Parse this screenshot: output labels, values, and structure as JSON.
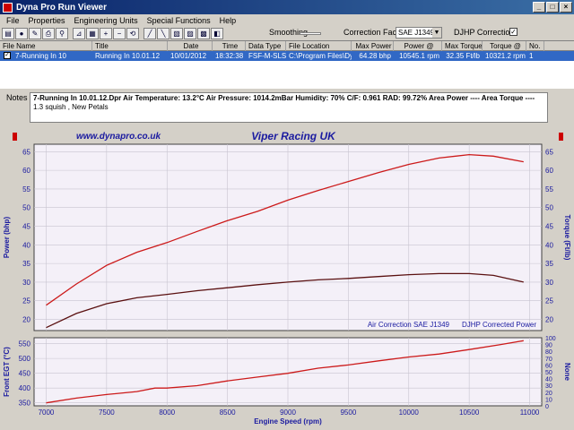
{
  "window": {
    "title": "Dyna Pro Run Viewer"
  },
  "menu": [
    "File",
    "Properties",
    "Engineering Units",
    "Special Functions",
    "Help"
  ],
  "toolbar": {
    "smoothing_label": "Smoothing",
    "correction_factor_label": "Correction Factor",
    "correction_factor_value": "SAE J1349",
    "djhp_label": "DJHP Correction",
    "djhp_checked": "✓"
  },
  "grid": {
    "headers": [
      "File Name",
      "Title",
      "Date",
      "Time",
      "Data Type",
      "File Location",
      "Max Power",
      "Power @",
      "Max Torque",
      "Torque @",
      "No."
    ],
    "rows": [
      [
        "7-Running In 10",
        "Running In 10.01.12",
        "10/01/2012",
        "18:32:38",
        "FSF-M-SLS",
        "C:\\Program Files\\Dy...",
        "64.28 bhp",
        "10545.1 rpm",
        "32.35 Ft/lb",
        "10321.2 rpm",
        "1"
      ]
    ]
  },
  "notes": {
    "label": "Notes",
    "line1": "7-Running In 10.01.12.Dpr   Air Temperature: 13.2°C   Air Pressure: 1014.2mBar   Humidity: 70%   C/F: 0.961   RAD: 99.72%   Area Power ----   Area Torque ----",
    "line2": "1.3 squish , New Petals"
  },
  "colors": {
    "power": "#cc1a1a",
    "torque": "#5a1010",
    "egt": "#cc1a1a",
    "plot_bg": "#f4f0f8",
    "accent_blue": "#1a1aa0"
  },
  "chart_data": [
    {
      "type": "line",
      "title": "Viper Racing UK",
      "subtitle": "www.dynapro.co.uk",
      "annotations": [
        "Air Correction SAE J1349",
        "DJHP Corrected Power"
      ],
      "xlabel": "",
      "ylabel": "Power (bhp)",
      "y2label": "Torque (Ft/lb)",
      "xlim": [
        6900,
        11100
      ],
      "ylim": [
        17,
        67
      ],
      "y2lim": [
        17,
        67
      ],
      "yticks": [
        20,
        25,
        30,
        35,
        40,
        45,
        50,
        55,
        60,
        65
      ],
      "grid": true,
      "series": [
        {
          "name": "Power (bhp)",
          "x": [
            7000,
            7250,
            7500,
            7750,
            8000,
            8250,
            8500,
            8750,
            9000,
            9250,
            9500,
            9750,
            10000,
            10250,
            10500,
            10700,
            10950
          ],
          "values": [
            23.8,
            29.5,
            34.5,
            38.0,
            40.6,
            43.6,
            46.5,
            49.0,
            52.0,
            54.6,
            57.0,
            59.4,
            61.6,
            63.3,
            64.2,
            63.8,
            62.3
          ]
        },
        {
          "name": "Torque (Ft/lb)",
          "x": [
            7000,
            7250,
            7500,
            7750,
            8000,
            8250,
            8500,
            8750,
            9000,
            9250,
            9500,
            9750,
            10000,
            10250,
            10500,
            10700,
            10950
          ],
          "values": [
            17.8,
            21.6,
            24.2,
            25.8,
            26.7,
            27.7,
            28.5,
            29.3,
            30.0,
            30.6,
            31.0,
            31.5,
            32.0,
            32.3,
            32.3,
            31.8,
            30.0
          ]
        }
      ]
    },
    {
      "type": "line",
      "xlabel": "Engine Speed (rpm)",
      "ylabel": "Front EGT (°C)",
      "y2label": "None",
      "xlim": [
        6900,
        11100
      ],
      "ylim": [
        340,
        570
      ],
      "y2lim": [
        0,
        100
      ],
      "yticks": [
        350,
        400,
        450,
        500,
        550
      ],
      "y2ticks": [
        0,
        10,
        20,
        30,
        40,
        50,
        60,
        70,
        80,
        90,
        100
      ],
      "xticks": [
        7000,
        7500,
        8000,
        8500,
        9000,
        9500,
        10000,
        10500,
        11000
      ],
      "grid": true,
      "series": [
        {
          "name": "Front EGT (°C)",
          "x": [
            7000,
            7250,
            7500,
            7750,
            7900,
            8000,
            8250,
            8500,
            8750,
            9000,
            9250,
            9500,
            9750,
            10000,
            10250,
            10500,
            10750,
            10950
          ],
          "values": [
            350,
            366,
            378,
            388,
            400,
            400,
            408,
            424,
            437,
            450,
            467,
            478,
            492,
            505,
            515,
            530,
            546,
            560
          ]
        }
      ]
    }
  ]
}
